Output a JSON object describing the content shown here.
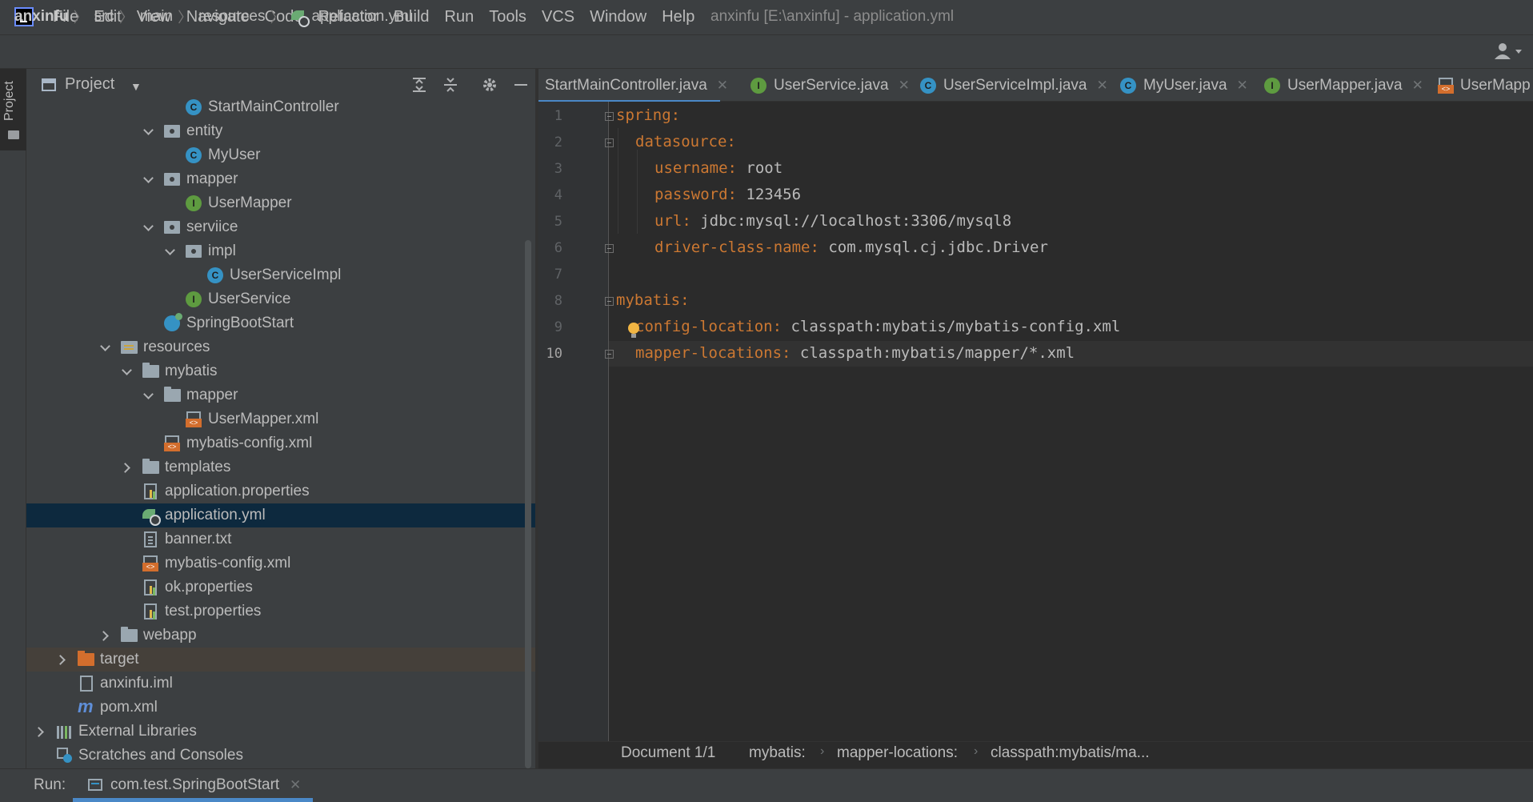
{
  "menubar": {
    "items": [
      "File",
      "Edit",
      "View",
      "Navigate",
      "Code",
      "Refactor",
      "Build",
      "Run",
      "Tools",
      "VCS",
      "Window",
      "Help"
    ],
    "window_title": "anxinfu [E:\\anxinfu] - application.yml"
  },
  "breadcrumb": [
    "anxinfu",
    "src",
    "main",
    "resources",
    "application.yml"
  ],
  "tool_strip": {
    "project_label": "Project"
  },
  "project_panel": {
    "title": "Project",
    "tree": [
      {
        "label": "StartMainController",
        "icon": "class-icon"
      },
      {
        "label": "entity",
        "icon": "package-icon",
        "expanded": true
      },
      {
        "label": "MyUser",
        "icon": "class-icon"
      },
      {
        "label": "mapper",
        "icon": "package-icon",
        "expanded": true
      },
      {
        "label": "UserMapper",
        "icon": "interface-icon"
      },
      {
        "label": "serviice",
        "icon": "package-icon",
        "expanded": true
      },
      {
        "label": "impl",
        "icon": "package-icon",
        "expanded": true
      },
      {
        "label": "UserServiceImpl",
        "icon": "class-icon"
      },
      {
        "label": "UserService",
        "icon": "interface-icon"
      },
      {
        "label": "SpringBootStart",
        "icon": "spring-boot-class-icon"
      },
      {
        "label": "resources",
        "icon": "resources-folder-icon",
        "expanded": true
      },
      {
        "label": "mybatis",
        "icon": "folder-icon",
        "expanded": true
      },
      {
        "label": "mapper",
        "icon": "folder-icon",
        "expanded": true
      },
      {
        "label": "UserMapper.xml",
        "icon": "xml-file-icon"
      },
      {
        "label": "mybatis-config.xml",
        "icon": "xml-file-icon"
      },
      {
        "label": "templates",
        "icon": "folder-icon",
        "expanded": false
      },
      {
        "label": "application.properties",
        "icon": "properties-file-icon"
      },
      {
        "label": "application.yml",
        "icon": "yaml-file-icon",
        "selected": true
      },
      {
        "label": "banner.txt",
        "icon": "text-file-icon"
      },
      {
        "label": "mybatis-config.xml",
        "icon": "xml-file-icon"
      },
      {
        "label": "ok.properties",
        "icon": "properties-file-icon"
      },
      {
        "label": "test.properties",
        "icon": "properties-file-icon"
      },
      {
        "label": "webapp",
        "icon": "folder-icon",
        "expanded": false
      },
      {
        "label": "target",
        "icon": "excluded-folder-icon",
        "expanded": false
      },
      {
        "label": "anxinfu.iml",
        "icon": "iml-file-icon"
      },
      {
        "label": "pom.xml",
        "icon": "maven-icon"
      },
      {
        "label": "External Libraries",
        "icon": "libraries-icon",
        "expanded": false
      },
      {
        "label": "Scratches and Consoles",
        "icon": "scratches-icon"
      }
    ]
  },
  "editor": {
    "tabs": [
      {
        "label": "StartMainController.java",
        "active": true
      },
      {
        "label": "UserService.java",
        "icon": "interface-icon"
      },
      {
        "label": "UserServiceImpl.java",
        "icon": "class-icon"
      },
      {
        "label": "MyUser.java",
        "icon": "class-icon"
      },
      {
        "label": "UserMapper.java",
        "icon": "interface-icon"
      },
      {
        "label": "UserMapp",
        "icon": "xml-file-icon"
      }
    ],
    "line_numbers": [
      "1",
      "2",
      "3",
      "4",
      "5",
      "6",
      "7",
      "8",
      "9",
      "10"
    ],
    "code": [
      {
        "key": "spring",
        "sep": ":",
        "value": ""
      },
      {
        "key": "datasource",
        "sep": ":",
        "value": ""
      },
      {
        "key": "username",
        "sep": ":",
        "value": " root"
      },
      {
        "key": "password",
        "sep": ":",
        "value": " 123456"
      },
      {
        "key": "url",
        "sep": ":",
        "value": " jdbc:mysql://localhost:3306/mysql8"
      },
      {
        "key": "driver-class-name",
        "sep": ":",
        "value": " com.mysql.cj.jdbc.Driver"
      },
      {
        "key": "",
        "sep": "",
        "value": ""
      },
      {
        "key": "mybatis",
        "sep": ":",
        "value": ""
      },
      {
        "key": "config-location",
        "sep": ":",
        "value": " classpath:mybatis/mybatis-config.xml"
      },
      {
        "key": "mapper-locations",
        "sep": ":",
        "value": " classpath:mybatis/mapper/*.xml"
      }
    ],
    "crumbs": [
      "Document 1/1",
      "mybatis:",
      "mapper-locations:",
      "classpath:mybatis/ma..."
    ]
  },
  "run": {
    "label": "Run:",
    "tab_label": "com.test.SpringBootStart"
  },
  "colors": {
    "background": "#2b2b2b",
    "panel": "#3c3f41",
    "key": "#cc7832",
    "selection": "#0d293e",
    "accent": "#4a88c7"
  }
}
